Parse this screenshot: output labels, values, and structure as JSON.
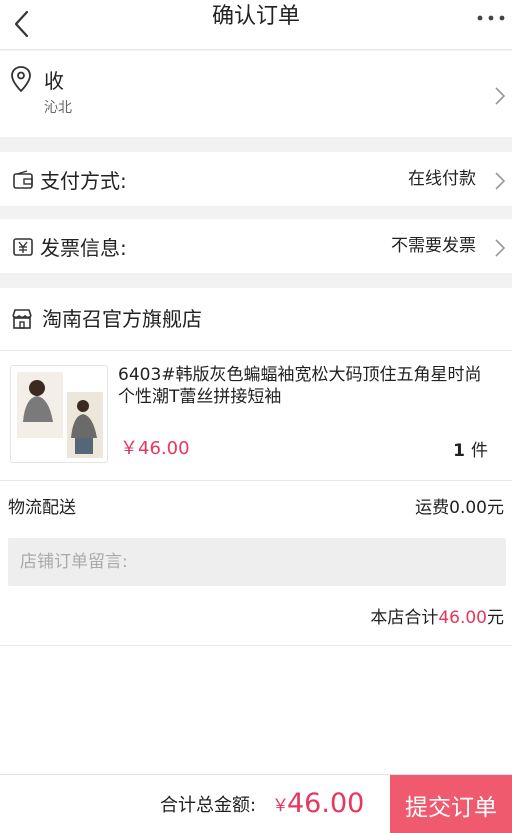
{
  "header": {
    "title": "确认订单",
    "back_icon": "chevron-left-icon",
    "more_icon": "more-dots-icon"
  },
  "address": {
    "name": "收",
    "line2": "沁北"
  },
  "payment": {
    "label": "支付方式:",
    "value": "在线付款"
  },
  "invoice": {
    "label": "发票信息:",
    "value": "不需要发票"
  },
  "shop": {
    "name": "淘南召官方旗舰店",
    "product": {
      "title": "6403#韩版灰色蝙蝠袖宽松大码顶住五角星时尚个性潮T蕾丝拼接短袖",
      "price": "￥46.00",
      "quantity": "1",
      "unit": "件"
    },
    "shipping": {
      "label": "物流配送",
      "fee": "运费0.00元"
    },
    "memo_placeholder": "店铺订单留言:",
    "subtotal": {
      "prefix": "本店合计",
      "amount": "46.00",
      "suffix": "元"
    }
  },
  "footer": {
    "total_label": "合计总金额:",
    "currency": "￥",
    "total": "46.00",
    "submit_label": "提交订单"
  },
  "colors": {
    "accent": "#e8365d",
    "submit_bg": "#f05a6f",
    "page_bg": "#f2f2f2"
  }
}
